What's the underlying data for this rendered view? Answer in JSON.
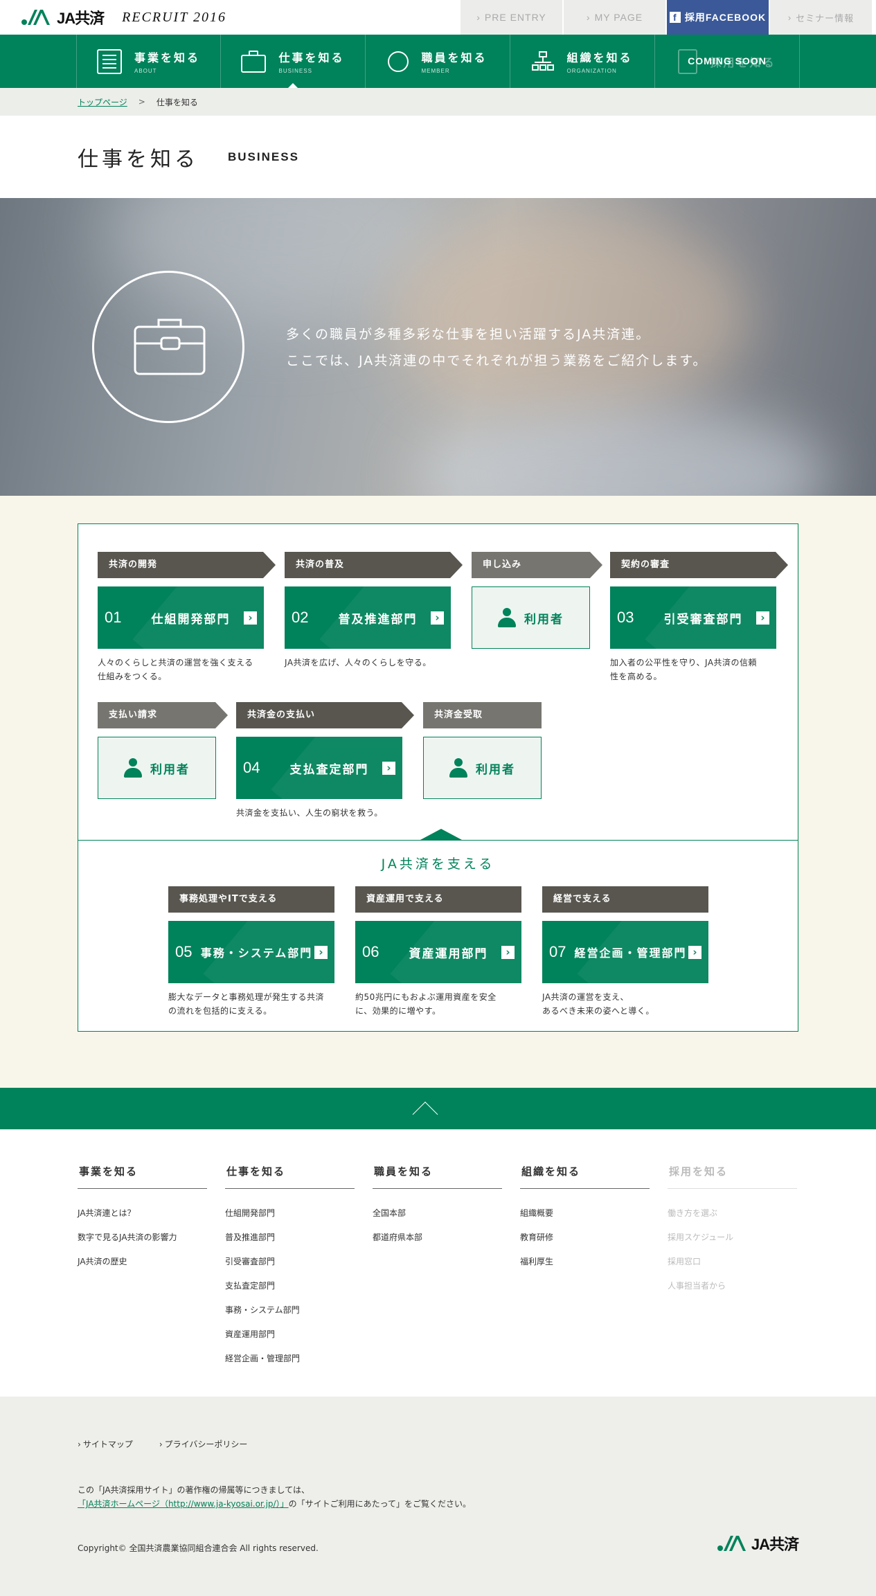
{
  "header": {
    "logo_text": "JA共済",
    "recruit": "RECRUIT 2016",
    "buttons": [
      {
        "label": "PRE ENTRY"
      },
      {
        "label": "MY PAGE"
      },
      {
        "label": "採用FACEBOOK"
      },
      {
        "label": "セミナー情報"
      }
    ]
  },
  "nav": [
    {
      "ja": "事業を知る",
      "en": "ABOUT"
    },
    {
      "ja": "仕事を知る",
      "en": "BUSINESS"
    },
    {
      "ja": "職員を知る",
      "en": "MEMBER"
    },
    {
      "ja": "組織を知る",
      "en": "ORGANIZATION"
    },
    {
      "ja": "採用を知る",
      "badge": "COMING SOON"
    }
  ],
  "breadcrumb": {
    "home": "トップページ",
    "sep": ">",
    "current": "仕事を知る"
  },
  "page_title": {
    "ja": "仕事を知る",
    "en": "BUSINESS"
  },
  "hero": {
    "line1": "多くの職員が多種多彩な仕事を担い活躍するJA共済連。",
    "line2": "ここでは、JA共済連の中でそれぞれが担う業務をご紹介します。"
  },
  "flow": {
    "row1": [
      {
        "label": "共済の開発",
        "num": "01",
        "name": "仕組開発部門",
        "desc1": "人々のくらしと共済の運営を強く支える",
        "desc2": "仕組みをつくる。"
      },
      {
        "label": "共済の普及",
        "num": "02",
        "name": "普及推進部門",
        "desc1": "JA共済を広げ、人々のくらしを守る。"
      },
      {
        "label": "申し込み",
        "user": "利用者"
      },
      {
        "label": "契約の審査",
        "num": "03",
        "name": "引受審査部門",
        "desc1": "加入者の公平性を守り、JA共済の信頼",
        "desc2": "性を高める。"
      }
    ],
    "row2": [
      {
        "label": "支払い請求",
        "user": "利用者"
      },
      {
        "label": "共済金の支払い",
        "num": "04",
        "name": "支払査定部門",
        "desc1": "共済金を支払い、人生の窮状を救う。"
      },
      {
        "label": "共済金受取",
        "user": "利用者"
      }
    ],
    "support_title": "JA共済を支える",
    "support": [
      {
        "label": "事務処理やITで支える",
        "num": "05",
        "name": "事務・システム部門",
        "desc1": "膨大なデータと事務処理が発生する共済",
        "desc2": "の流れを包括的に支える。"
      },
      {
        "label": "資産運用で支える",
        "num": "06",
        "name": "資産運用部門",
        "desc1": "約50兆円にもおよぶ運用資産を安全",
        "desc2": "に、効果的に増やす。"
      },
      {
        "label": "経営で支える",
        "num": "07",
        "name": "経営企画・管理部門",
        "desc1": "JA共済の運営を支え、",
        "desc2": "あるべき未来の姿へと導く。"
      }
    ]
  },
  "sitemap": [
    {
      "title": "事業を知る",
      "items": [
        "JA共済連とは？",
        "数字で見るJA共済の影響力",
        "JA共済の歴史"
      ]
    },
    {
      "title": "仕事を知る",
      "items": [
        "仕組開発部門",
        "普及推進部門",
        "引受審査部門",
        "支払査定部門",
        "事務・システム部門",
        "資産運用部門",
        "経営企画・管理部門"
      ]
    },
    {
      "title": "職員を知る",
      "items": [
        "全国本部",
        "都道府県本部"
      ]
    },
    {
      "title": "組織を知る",
      "items": [
        "組織概要",
        "教育研修",
        "福利厚生"
      ]
    },
    {
      "title": "採用を知る",
      "items": [
        "働き方を選ぶ",
        "採用スケジュール",
        "採用窓口",
        "人事担当者から"
      ]
    }
  ],
  "footer": {
    "links": [
      "サイトマップ",
      "プライバシーポリシー"
    ],
    "note1": "この「JA共済採用サイト」の著作権の帰属等につきましては、",
    "note_link": "「JA共済ホームページ（http://www.ja-kyosai.or.jp/）」",
    "note2": "の「サイトご利用にあたって」をご覧ください。",
    "copyright": "Copyright© 全国共済農業協同組合連合会 All rights reserved.",
    "logo_text": "JA共済"
  },
  "colors": {
    "brand": "#00825a",
    "facebook": "#3b5998",
    "dark_label": "#58564f",
    "cream": "#f8f6ea"
  }
}
